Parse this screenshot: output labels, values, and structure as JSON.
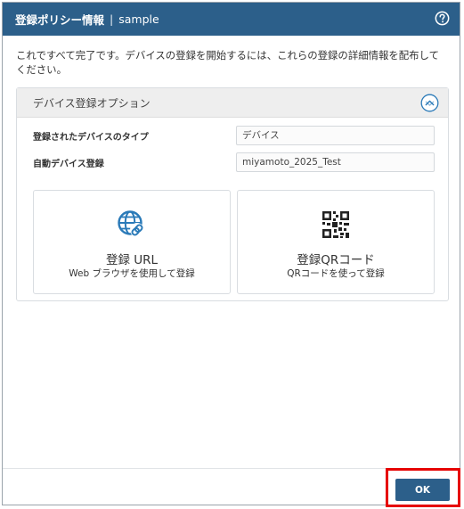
{
  "dialog": {
    "title": "登録ポリシー情報",
    "separator": "|",
    "subtitle": "sample",
    "help_icon": "question-circle-icon"
  },
  "intro_text": "これですべて完了です。デバイスの登録を開始するには、これらの登録の詳細情報を配布してください。",
  "panel": {
    "header": "デバイス登録オプション",
    "collapse_icon": "chevron-up-circle-icon",
    "fields": [
      {
        "label": "登録されたデバイスのタイプ",
        "value": "デバイス"
      },
      {
        "label": "自動デバイス登録",
        "value": "miyamoto_2025_Test"
      }
    ],
    "cards": [
      {
        "title": "登録 URL",
        "description": "Web ブラウザを使用して登録",
        "icon": "globe-link-icon"
      },
      {
        "title": "登録QRコード",
        "description": "QRコードを使って登録",
        "icon": "qr-code-icon"
      }
    ]
  },
  "footer": {
    "ok_label": "OK"
  },
  "colors": {
    "title_bar": "#2c5f8a",
    "globe_icon": "#2a7ab8",
    "ok_button": "#2c5f8a",
    "highlight": "#e60000"
  }
}
